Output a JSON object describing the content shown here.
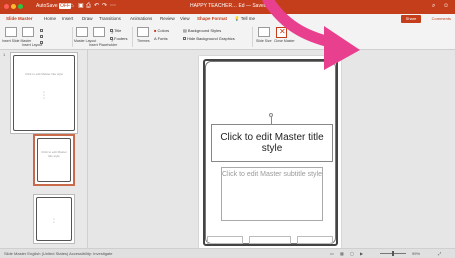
{
  "window": {
    "autosave_label": "AutoSave",
    "autosave_state": "OFF",
    "doc_title": "HAPPY TEACHER… Ed — Saved",
    "accent_color": "#c43e1c"
  },
  "ribbon_tabs": [
    "Slide Master",
    "Home",
    "Insert",
    "Draw",
    "Transitions",
    "Animations",
    "Review",
    "View",
    "Shape Format",
    "Tell me"
  ],
  "active_tab": "Slide Master",
  "share_label": "Share",
  "comments_label": "Comments",
  "ribbon": {
    "insert_slide_master": "Insert Slide Master",
    "insert_layout": "Insert Layout",
    "check_title": "Title",
    "check_footers": "Footers",
    "master_layout": "Master Layout",
    "insert_placeholder": "Insert Placeholder",
    "themes": "Themes",
    "colors": "Colors",
    "fonts": "Fonts",
    "background_styles": "Background Styles",
    "hide_background_graphics": "Hide Background Graphics",
    "slide_size": "Slide Size",
    "close_master": "Close Master"
  },
  "thumbnails": [
    {
      "num": "1",
      "title": "Click to edit Master title style",
      "subtitle": "",
      "selected": false
    },
    {
      "num": "",
      "title": "Click to edit Master title style",
      "subtitle": "",
      "selected": true
    },
    {
      "num": "",
      "title": "",
      "subtitle": "",
      "selected": false
    }
  ],
  "slide": {
    "title_placeholder": "Click to edit Master title style",
    "subtitle_placeholder": "Click to edit Master subtitle style",
    "footer_left": "",
    "footer_center": "",
    "footer_right": ""
  },
  "statusbar": {
    "left_text": "Slide Master   English (United States)   Accessibility: Investigate",
    "zoom": "99%"
  }
}
